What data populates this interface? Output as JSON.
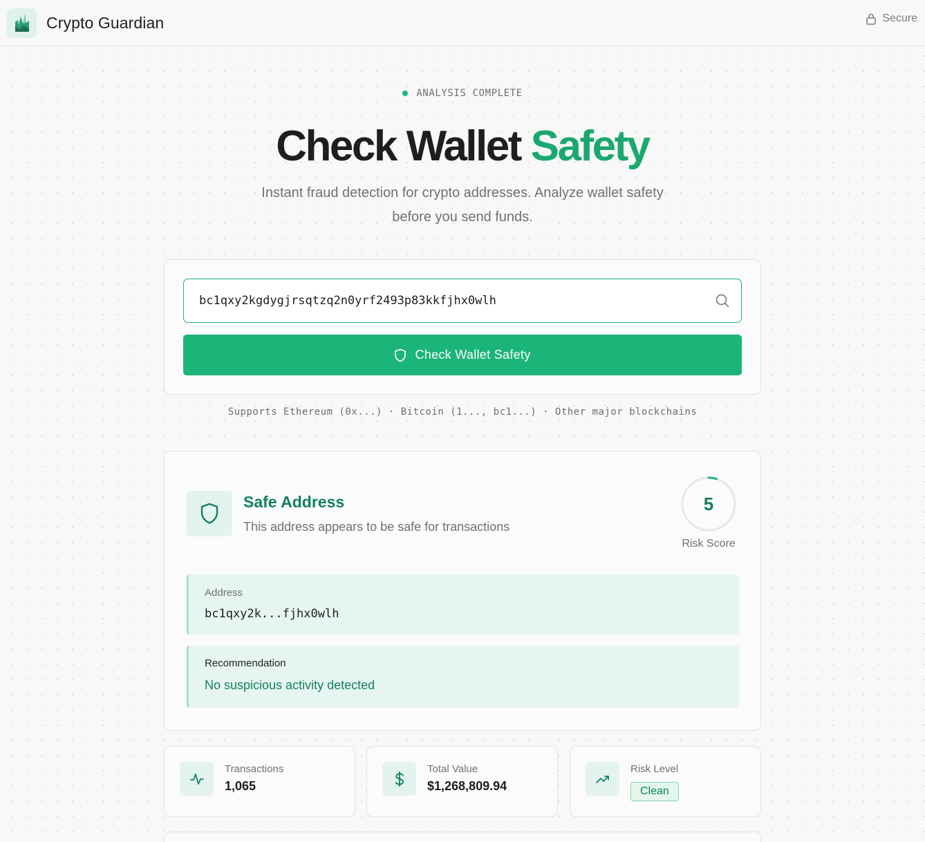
{
  "header": {
    "brand": "Crypto Guardian",
    "secure_label": "Secure"
  },
  "hero": {
    "status": "ANALYSIS COMPLETE",
    "title_main": "Check Wallet",
    "title_accent": "Safety",
    "subtitle": "Instant fraud detection for crypto addresses. Analyze wallet safety before you send funds."
  },
  "search": {
    "value": "bc1qxy2kgdygjrsqtzq2n0yrf2493p83kkfjhx0wlh",
    "button_label": "Check Wallet Safety",
    "supports": "Supports Ethereum (0x...) · Bitcoin (1..., bc1...) · Other major blockchains"
  },
  "result": {
    "title": "Safe Address",
    "description": "This address appears to be safe for transactions",
    "risk_score": 5,
    "risk_label": "Risk Score",
    "address_label": "Address",
    "address_value": "bc1qxy2k...fjhx0wlh",
    "recommendation_label": "Recommendation",
    "recommendation_value": "No suspicious activity detected"
  },
  "stats": {
    "transactions_label": "Transactions",
    "transactions_value": "1,065",
    "total_value_label": "Total Value",
    "total_value_value": "$1,268,809.94",
    "risk_level_label": "Risk Level",
    "risk_level_value": "Clean"
  },
  "colors": {
    "accent": "#1bb479",
    "accent_dark": "#14805a",
    "soft_green": "#e6f6ee"
  }
}
